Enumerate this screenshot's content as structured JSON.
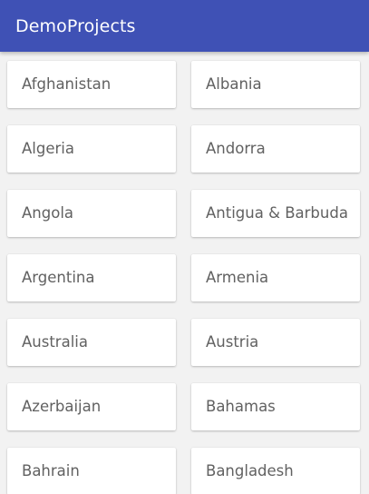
{
  "app_bar": {
    "title": "DemoProjects",
    "color": "#3f51b5"
  },
  "countries": [
    "Afghanistan",
    "Albania",
    "Algeria",
    "Andorra",
    "Angola",
    "Antigua & Barbuda",
    "Argentina",
    "Armenia",
    "Australia",
    "Austria",
    "Azerbaijan",
    "Bahamas",
    "Bahrain",
    "Bangladesh"
  ]
}
